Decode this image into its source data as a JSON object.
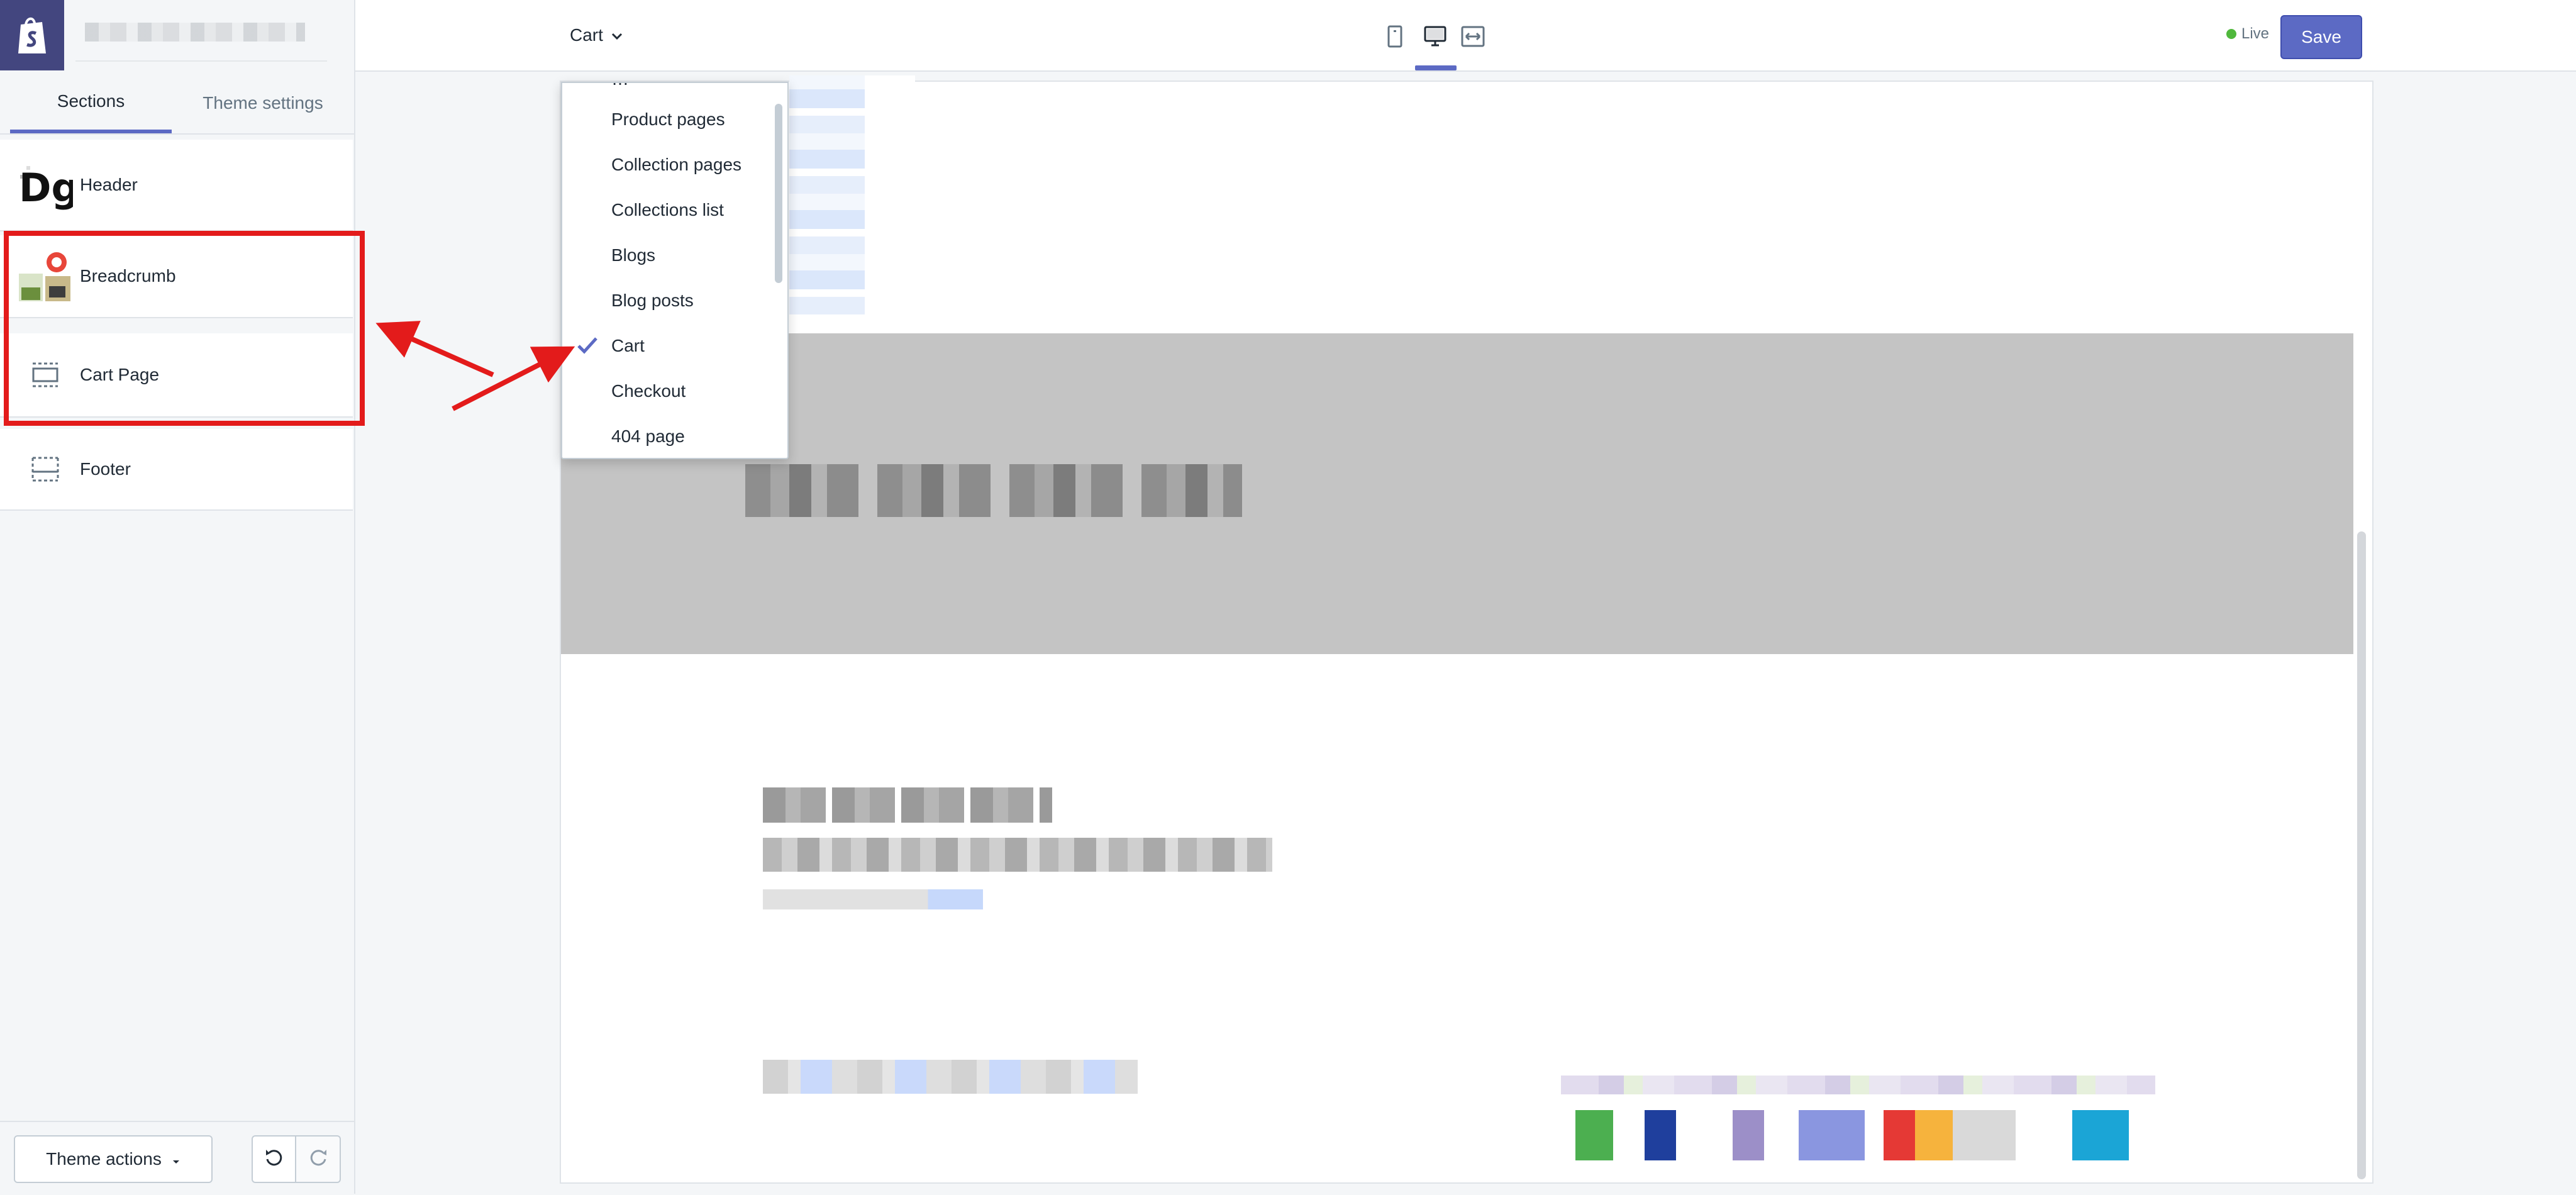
{
  "topbar": {
    "page_selector": "Cart",
    "live_label": "Live",
    "save_label": "Save"
  },
  "sidebar": {
    "tabs": [
      {
        "label": "Sections",
        "active": true
      },
      {
        "label": "Theme settings",
        "active": false
      }
    ],
    "sections": [
      {
        "label": "Header",
        "icon": "logo-thumbnail-icon"
      },
      {
        "label": "Breadcrumb",
        "icon": "image-thumbnail-icon"
      },
      {
        "label": "Cart Page",
        "icon": "section-icon"
      },
      {
        "label": "Footer",
        "icon": "section-icon"
      }
    ],
    "theme_actions_label": "Theme actions"
  },
  "dropdown": {
    "items": [
      {
        "label": "Product pages",
        "selected": false
      },
      {
        "label": "Collection pages",
        "selected": false
      },
      {
        "label": "Collections list",
        "selected": false
      },
      {
        "label": "Blogs",
        "selected": false
      },
      {
        "label": "Blog posts",
        "selected": false
      },
      {
        "label": "Cart",
        "selected": true
      },
      {
        "label": "Checkout",
        "selected": false
      },
      {
        "label": "404 page",
        "selected": false
      }
    ]
  },
  "colors": {
    "accent": "#5c6ac4",
    "live_dot": "#50b83c",
    "annotation_red": "#e31b1b",
    "sidebar_logo_bg": "#43467f"
  }
}
